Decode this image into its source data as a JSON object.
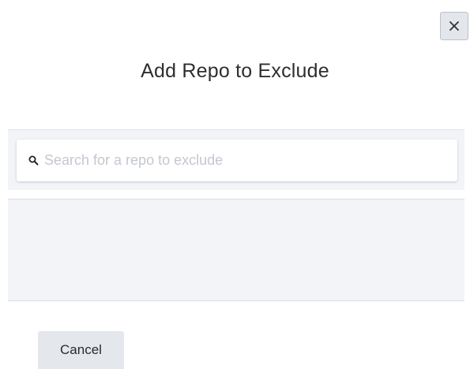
{
  "dialog": {
    "title": "Add Repo to Exclude",
    "close_icon": "close-icon"
  },
  "search": {
    "icon": "search-icon",
    "placeholder": "Search for a repo to exclude",
    "value": ""
  },
  "results": {
    "items": []
  },
  "footer": {
    "cancel_label": "Cancel"
  },
  "colors": {
    "panel_background": "#f2f4f7",
    "button_background": "#e4e7eb",
    "placeholder_text": "#c3c8d0",
    "title_text": "#2e2e2e"
  }
}
